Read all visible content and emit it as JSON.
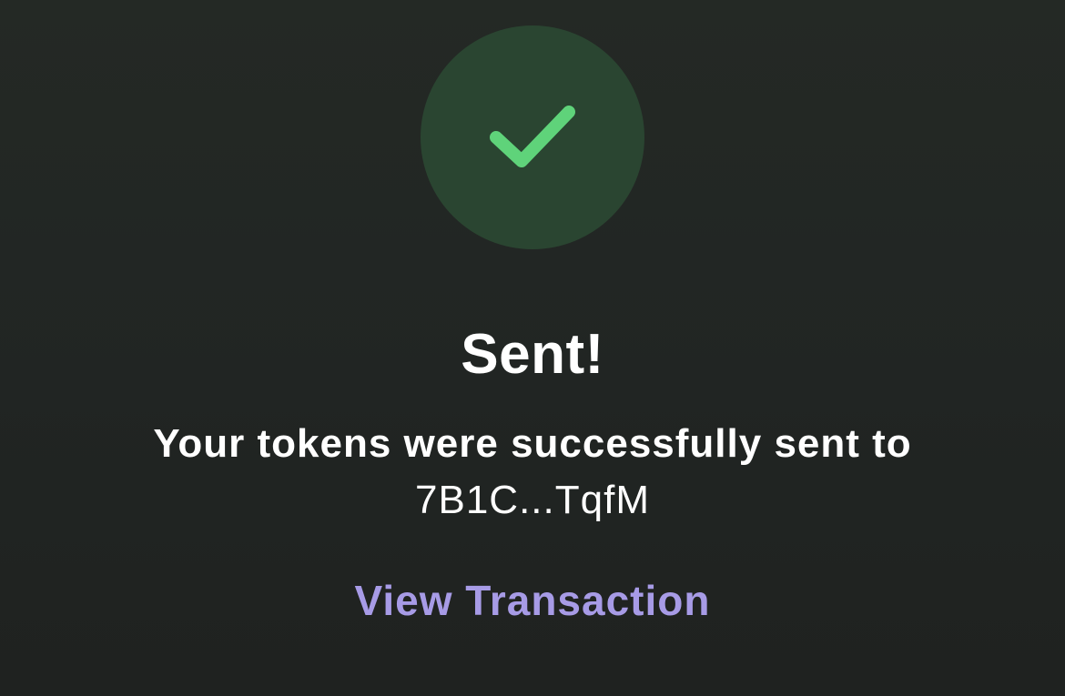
{
  "status": {
    "icon": "checkmark-icon",
    "icon_color": "#5fd37a",
    "circle_color": "#2a4531"
  },
  "title": "Sent!",
  "message": "Your tokens were successfully sent to",
  "recipient_address": "7B1C...TqfM",
  "actions": {
    "view_transaction_label": "View Transaction",
    "link_color": "#a79be6"
  }
}
